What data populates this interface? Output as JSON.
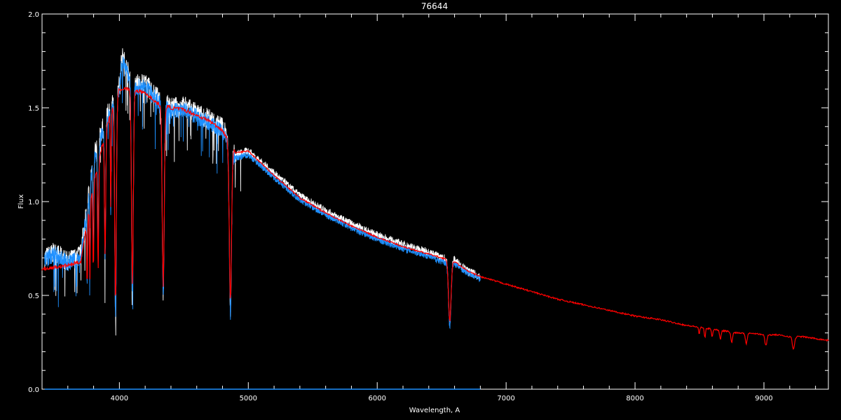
{
  "chart_data": {
    "type": "line",
    "title": "76644",
    "xlabel": "Wavelength, A",
    "ylabel": "Flux",
    "xlim": [
      3400,
      9500
    ],
    "ylim": [
      0.0,
      2.0
    ],
    "x_ticks": [
      4000,
      5000,
      6000,
      7000,
      8000,
      9000
    ],
    "x_tick_labels": [
      "4000",
      "5000",
      "6000",
      "7000",
      "8000",
      "9000"
    ],
    "y_ticks": [
      0.0,
      0.5,
      1.0,
      1.5,
      2.0
    ],
    "y_tick_labels": [
      "0.0",
      "0.5",
      "1.0",
      "1.5",
      "2.0"
    ],
    "background": "#000000",
    "axis_color": "#ffffff",
    "grid": false,
    "series": [
      {
        "color": "#ffffff",
        "x": [
          3420,
          3500,
          3600,
          3700,
          3800,
          3900,
          4000,
          4020,
          4100,
          4200,
          4300,
          4400,
          4500,
          4600,
          4700,
          4800,
          4900,
          5000,
          5200,
          5400,
          5600,
          5800,
          6000,
          6200,
          6400,
          6500,
          6600,
          6700,
          6800
        ],
        "y": [
          0.7,
          0.73,
          0.68,
          0.72,
          1.25,
          1.45,
          1.62,
          1.78,
          1.63,
          1.63,
          1.55,
          1.5,
          1.51,
          1.47,
          1.44,
          1.4,
          1.25,
          1.27,
          1.15,
          1.03,
          0.95,
          0.88,
          0.82,
          0.77,
          0.73,
          0.7,
          0.69,
          0.63,
          0.6
        ]
      },
      {
        "color": "#1e90ff",
        "x": [
          3420,
          3500,
          3600,
          3700,
          3800,
          3900,
          4000,
          4020,
          4100,
          4200,
          4300,
          4400,
          4500,
          4600,
          4700,
          4800,
          4900,
          5000,
          5200,
          5400,
          5600,
          5800,
          6000,
          6200,
          6400,
          6500,
          6600,
          6700,
          6800
        ],
        "y": [
          0.69,
          0.72,
          0.67,
          0.7,
          1.22,
          1.43,
          1.6,
          1.76,
          1.61,
          1.61,
          1.53,
          1.48,
          1.49,
          1.45,
          1.42,
          1.37,
          1.23,
          1.25,
          1.13,
          1.01,
          0.93,
          0.86,
          0.8,
          0.75,
          0.71,
          0.68,
          0.67,
          0.62,
          0.59
        ]
      },
      {
        "color": "#ff0000",
        "x": [
          3400,
          3600,
          3700,
          3800,
          3900,
          4000,
          4100,
          4200,
          4300,
          4400,
          4500,
          4700,
          4800,
          4900,
          5000,
          5200,
          5400,
          5600,
          5800,
          6000,
          6200,
          6400,
          6500,
          6600,
          6700,
          6800,
          7000,
          7200,
          7400,
          7600,
          7800,
          8000,
          8200,
          8400,
          8500,
          8600,
          8700,
          8800,
          8900,
          9000,
          9100,
          9200,
          9300,
          9400,
          9500
        ],
        "y": [
          0.64,
          0.66,
          0.68,
          1.1,
          1.4,
          1.6,
          1.6,
          1.58,
          1.52,
          1.5,
          1.49,
          1.43,
          1.38,
          1.26,
          1.27,
          1.14,
          1.02,
          0.94,
          0.87,
          0.81,
          0.76,
          0.72,
          0.7,
          0.68,
          0.63,
          0.6,
          0.56,
          0.52,
          0.48,
          0.45,
          0.42,
          0.39,
          0.37,
          0.34,
          0.33,
          0.32,
          0.31,
          0.3,
          0.3,
          0.29,
          0.29,
          0.28,
          0.28,
          0.27,
          0.26
        ]
      }
    ],
    "absorption_lines": [
      {
        "x": 3750,
        "depth": 0.4,
        "width": 4
      },
      {
        "x": 3771,
        "depth": 0.45,
        "width": 4
      },
      {
        "x": 3798,
        "depth": 0.5,
        "width": 5
      },
      {
        "x": 3835,
        "depth": 0.6,
        "width": 6
      },
      {
        "x": 3889,
        "depth": 0.7,
        "width": 7
      },
      {
        "x": 3933,
        "depth": 0.55,
        "width": 4
      },
      {
        "x": 3970,
        "depth": 1.15,
        "width": 9
      },
      {
        "x": 4101,
        "depth": 1.1,
        "width": 10
      },
      {
        "x": 4340,
        "depth": 1.02,
        "width": 11
      },
      {
        "x": 4861,
        "depth": 0.88,
        "width": 12
      },
      {
        "x": 6563,
        "depth": 0.34,
        "width": 14
      }
    ],
    "red_tail_lines": [
      {
        "x": 8498,
        "depth": 0.04,
        "width": 6
      },
      {
        "x": 8542,
        "depth": 0.05,
        "width": 7
      },
      {
        "x": 8598,
        "depth": 0.04,
        "width": 7
      },
      {
        "x": 8662,
        "depth": 0.05,
        "width": 8
      },
      {
        "x": 8750,
        "depth": 0.06,
        "width": 9
      },
      {
        "x": 8863,
        "depth": 0.06,
        "width": 10
      },
      {
        "x": 9015,
        "depth": 0.06,
        "width": 11
      },
      {
        "x": 9229,
        "depth": 0.07,
        "width": 12
      }
    ]
  }
}
